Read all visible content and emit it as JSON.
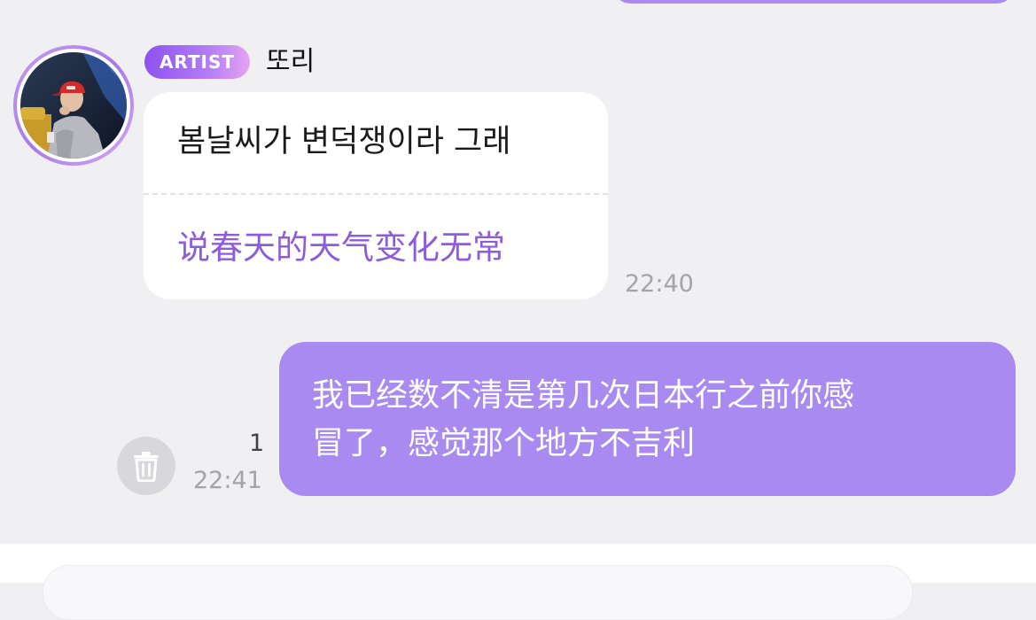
{
  "artist_message": {
    "badge": "ARTIST",
    "name": "또리",
    "original_text": "봄날씨가 변덕쟁이라 그래",
    "translation": "说春天的天气变化无常",
    "time": "22:40"
  },
  "my_message": {
    "lines": [
      "我已经数不清是第几次日本行之前你感",
      "冒了，感觉那个地方不吉利"
    ],
    "unread_count": "1",
    "time": "22:41"
  },
  "icons": {
    "delete": "trash-icon"
  },
  "colors": {
    "background": "#f0f0f2",
    "my_bubble": "#a98af0",
    "translation_text": "#8d5cdc",
    "badge_start": "#8f52f0",
    "badge_end": "#e6a3f3"
  }
}
